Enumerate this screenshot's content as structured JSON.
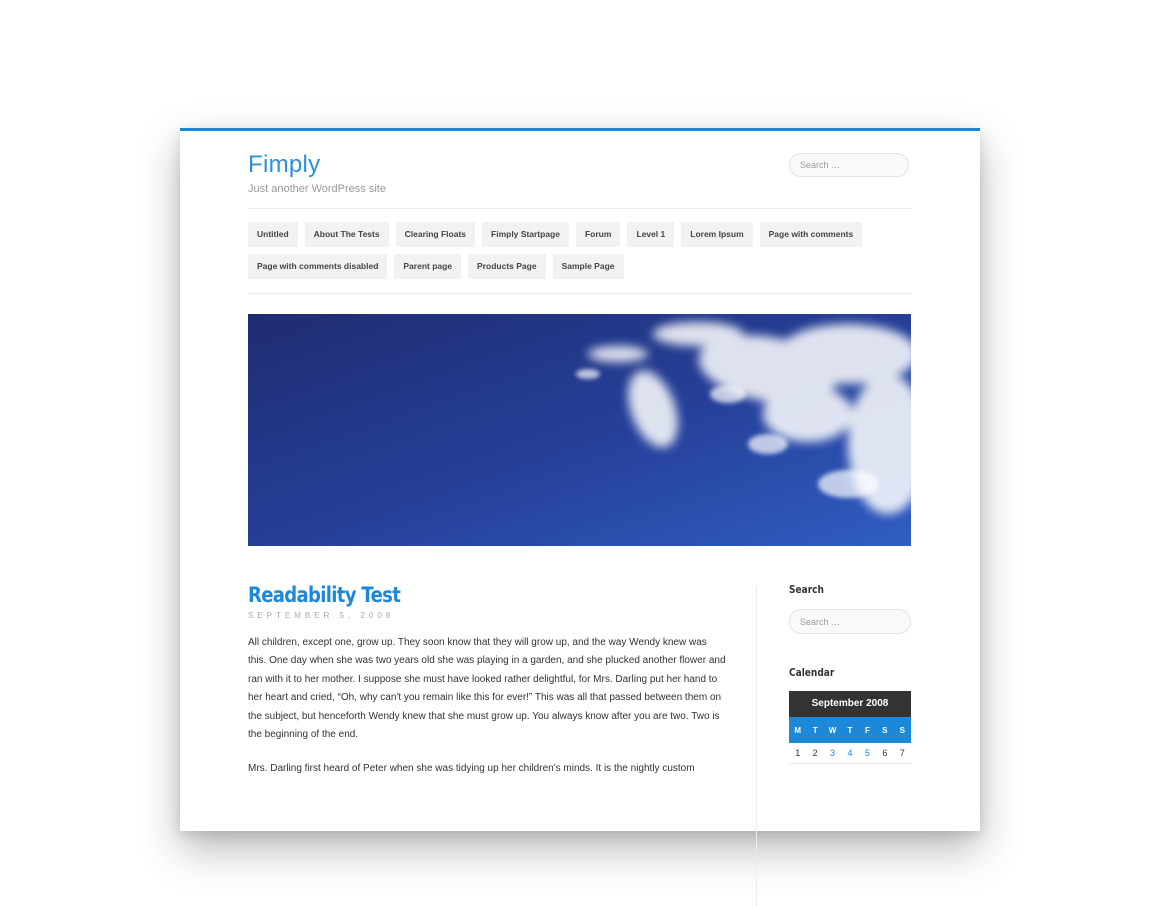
{
  "header": {
    "site_title": "Fimply",
    "site_description": "Just another WordPress site",
    "search_placeholder": "Search …"
  },
  "nav": {
    "row1": [
      "Untitled",
      "About The Tests",
      "Clearing Floats",
      "Fimply Startpage",
      "Forum",
      "Level 1",
      "Lorem Ipsum",
      "Page with comments"
    ],
    "row2": [
      "Page with comments disabled",
      "Parent page",
      "Products Page",
      "Sample Page"
    ]
  },
  "post": {
    "title": "Readability Test",
    "date": "SEPTEMBER 5, 2008",
    "paragraphs": [
      "All children, except one, grow up. They soon know that they will grow up, and the way Wendy knew was this. One day when she was two years old she was playing in a garden, and she plucked another flower and ran with it to her mother. I suppose she must have looked rather delightful, for Mrs. Darling put her hand to her heart and cried, “Oh, why can't you remain like this for ever!” This was all that passed between them on the subject, but henceforth Wendy knew that she must grow up. You always know after you are two. Two is the beginning of the end.",
      "Mrs. Darling first heard of Peter when she was tidying up her children's minds. It is the nightly custom"
    ]
  },
  "sidebar": {
    "search_title": "Search",
    "search_placeholder": "Search …",
    "calendar_title": "Calendar",
    "calendar": {
      "caption": "September 2008",
      "days": [
        "M",
        "T",
        "W",
        "T",
        "F",
        "S",
        "S"
      ],
      "first_row": [
        "1",
        "2",
        "3",
        "4",
        "5",
        "6",
        "7"
      ],
      "linked_days": [
        "3",
        "4",
        "5"
      ]
    }
  },
  "colors": {
    "accent": "#1e88d8",
    "calendar_caption_bg": "#333333"
  }
}
